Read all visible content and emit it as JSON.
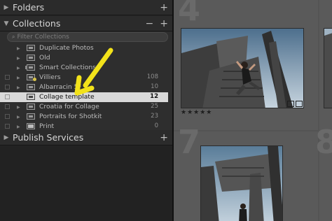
{
  "panels": {
    "folders": {
      "title": "Folders",
      "add": "+"
    },
    "collections": {
      "title": "Collections",
      "minus": "−",
      "add": "+",
      "filter_placeholder": "Filter Collections",
      "items": [
        {
          "label": "Duplicate Photos",
          "count": "",
          "selected": false
        },
        {
          "label": "Old",
          "count": "",
          "selected": false
        },
        {
          "label": "Smart Collections",
          "count": "",
          "selected": false
        },
        {
          "label": "Villiers",
          "count": "108",
          "selected": false
        },
        {
          "label": "Albarracin 5*",
          "count": "10",
          "selected": false
        },
        {
          "label": "Collage template",
          "count": "12",
          "selected": true
        },
        {
          "label": "Croatia for Collage",
          "count": "25",
          "selected": false
        },
        {
          "label": "Portraits for Shotkit",
          "count": "23",
          "selected": false
        },
        {
          "label": "Print",
          "count": "0",
          "selected": false
        }
      ]
    },
    "publish": {
      "title": "Publish Services",
      "add": "+"
    }
  },
  "grid": {
    "cells": [
      {
        "number": "4",
        "rating": "★★★★★"
      },
      {
        "number": "7",
        "rating": ""
      },
      {
        "number": "8",
        "rating": ""
      }
    ]
  },
  "annotation": {
    "arrow_color": "#f2e21a"
  },
  "colors": {
    "selected_row": "#d9d9d9",
    "grid_bg": "#545454"
  }
}
